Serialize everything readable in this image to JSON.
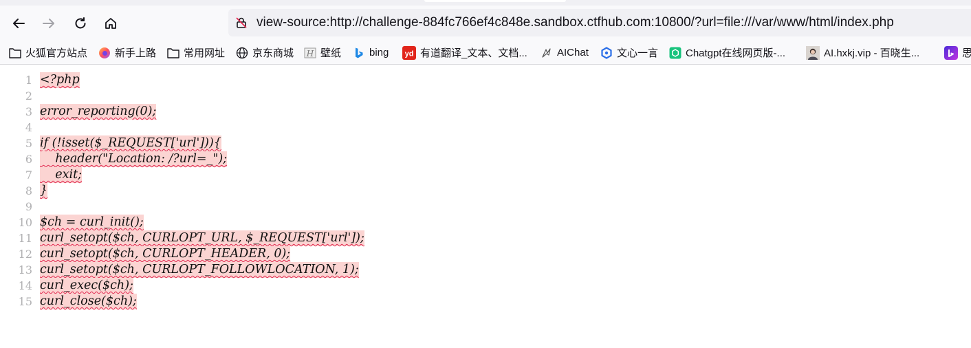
{
  "address_bar": {
    "url": "view-source:http://challenge-884fc766ef4c848e.sandbox.ctfhub.com:10800/?url=file:///var/www/html/index.php"
  },
  "bookmarks": [
    {
      "label": "火狐官方站点",
      "icon": "folder-icon"
    },
    {
      "label": "新手上路",
      "icon": "firefox-icon"
    },
    {
      "label": "常用网址",
      "icon": "folder-icon"
    },
    {
      "label": "京东商城",
      "icon": "globe-icon"
    },
    {
      "label": "壁纸",
      "icon": "wallpaper-icon"
    },
    {
      "label": "bing",
      "icon": "bing-icon"
    },
    {
      "label": "有道翻译_文本、文档...",
      "icon": "youdao-icon"
    },
    {
      "label": "AIChat",
      "icon": "aichat-icon"
    },
    {
      "label": "文心一言",
      "icon": "wenxin-icon"
    },
    {
      "label": "Chatgpt在线网页版-...",
      "icon": "chatgpt-icon"
    },
    {
      "label": "AI.hxkj.vip - 百晓生...",
      "icon": "avatar-icon"
    },
    {
      "label": "思",
      "icon": "app-icon"
    }
  ],
  "source": {
    "lines": [
      {
        "num": "1",
        "text": "<?php"
      },
      {
        "num": "2",
        "text": ""
      },
      {
        "num": "3",
        "text": "error_reporting(0);"
      },
      {
        "num": "4",
        "text": ""
      },
      {
        "num": "5",
        "text": "if (!isset($_REQUEST['url'])){"
      },
      {
        "num": "6",
        "text": "    header(\"Location: /?url=_\");"
      },
      {
        "num": "7",
        "text": "    exit;"
      },
      {
        "num": "8",
        "text": "}"
      },
      {
        "num": "9",
        "text": ""
      },
      {
        "num": "10",
        "text": "$ch = curl_init();"
      },
      {
        "num": "11",
        "text": "curl_setopt($ch, CURLOPT_URL, $_REQUEST['url']);"
      },
      {
        "num": "12",
        "text": "curl_setopt($ch, CURLOPT_HEADER, 0);"
      },
      {
        "num": "13",
        "text": "curl_setopt($ch, CURLOPT_FOLLOWLOCATION, 1);"
      },
      {
        "num": "14",
        "text": "curl_exec($ch);"
      },
      {
        "num": "15",
        "text": "curl_close($ch);"
      }
    ]
  },
  "colors": {
    "highlight": "#fbd4d2",
    "squiggle": "#e22850",
    "line_number": "#b1b1b3"
  }
}
